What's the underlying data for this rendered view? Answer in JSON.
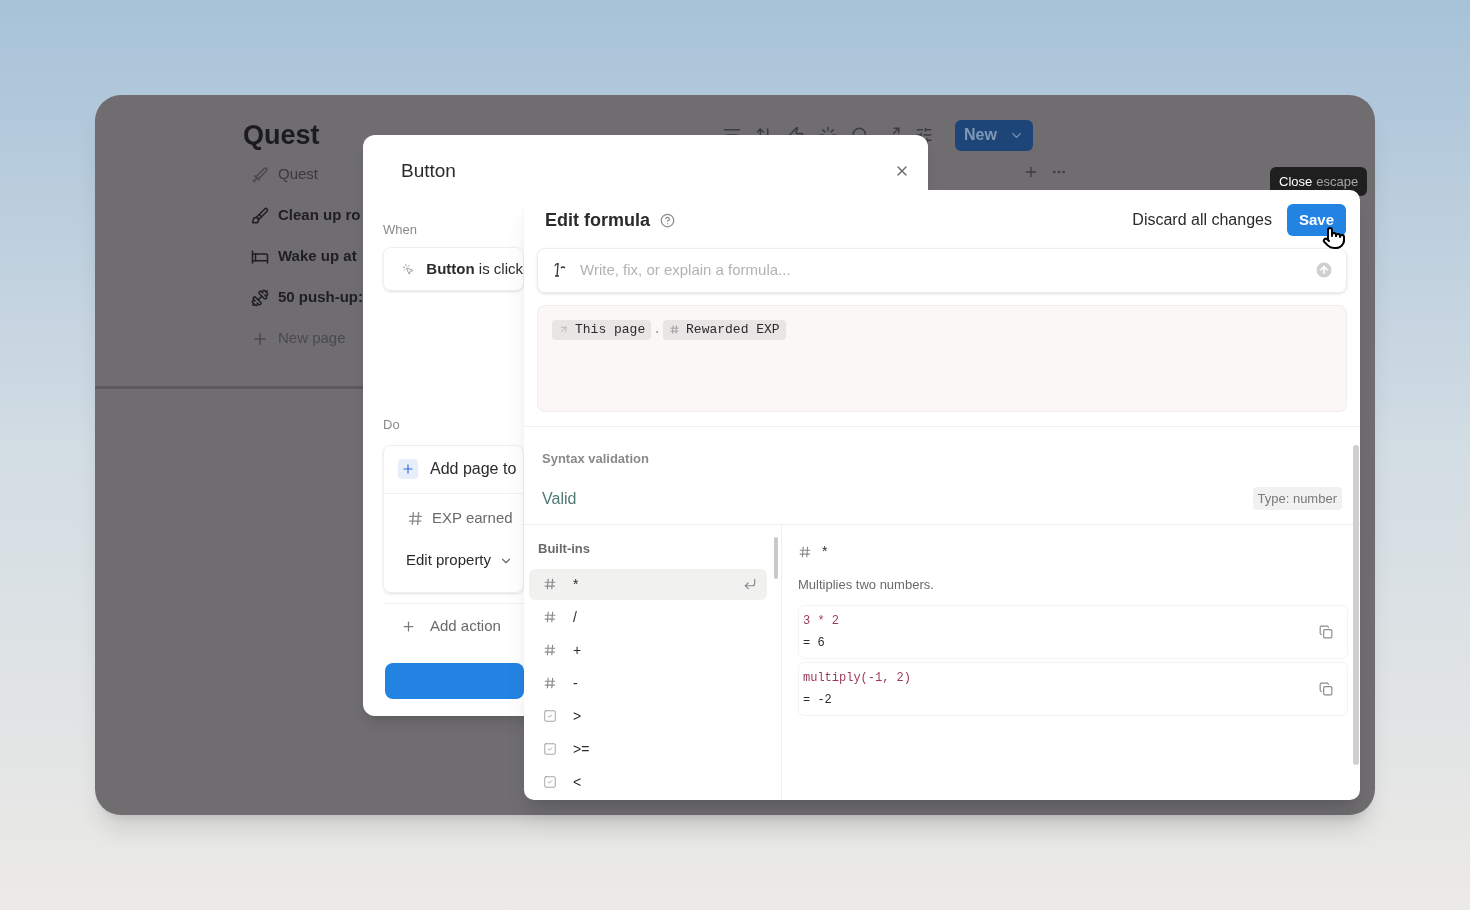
{
  "page": {
    "title": "Quest",
    "items": [
      {
        "kind": "view",
        "label": "Quest"
      },
      {
        "kind": "page",
        "label": "Clean up ro"
      },
      {
        "kind": "page",
        "label": "Wake up at"
      },
      {
        "kind": "page",
        "label": "50 push-up:"
      },
      {
        "kind": "new",
        "label": "New page"
      }
    ],
    "new_button": "New"
  },
  "button_dialog": {
    "title": "Button",
    "when_label": "When",
    "trigger": {
      "bold": "Button",
      "rest": " is click"
    },
    "do_label": "Do",
    "action": {
      "title": "Add page to",
      "property": "EXP earned",
      "edit": "Edit property"
    },
    "add_action": "Add action"
  },
  "tooltip": {
    "label": "Close",
    "shortcut": "escape"
  },
  "formula": {
    "title": "Edit formula",
    "discard": "Discard all changes",
    "save": "Save",
    "ai_placeholder": "Write, fix, or explain a formula...",
    "tokens": [
      {
        "kind": "relation",
        "label": "This page"
      },
      {
        "kind": "separator",
        "label": "."
      },
      {
        "kind": "number",
        "label": "Rewarded EXP"
      }
    ],
    "validation_label": "Syntax validation",
    "validation": "Valid",
    "type_badge": "Type: number",
    "builtins_label": "Built-ins",
    "builtins": [
      {
        "kind": "number",
        "label": "*",
        "selected": true
      },
      {
        "kind": "number",
        "label": "/",
        "selected": false
      },
      {
        "kind": "number",
        "label": "+",
        "selected": false
      },
      {
        "kind": "number",
        "label": "-",
        "selected": false
      },
      {
        "kind": "checkbox",
        "label": ">",
        "selected": false
      },
      {
        "kind": "checkbox",
        "label": ">=",
        "selected": false
      },
      {
        "kind": "checkbox",
        "label": "<",
        "selected": false
      }
    ],
    "detail": {
      "kind": "number",
      "name": "*",
      "description": "Multiplies two numbers.",
      "examples": [
        {
          "code": "3 * 2",
          "result": "= 6"
        },
        {
          "code": "multiply(-1, 2)",
          "result": "= -2"
        }
      ]
    }
  }
}
